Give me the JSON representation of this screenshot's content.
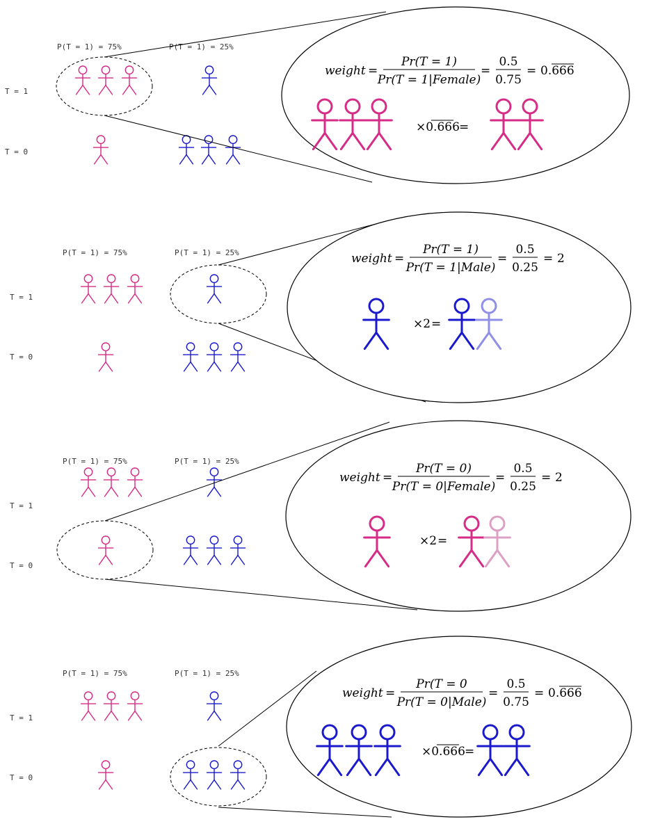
{
  "colors": {
    "female": "#d62b86",
    "female_light": "#dda0c4",
    "male": "#1a1acc",
    "male_light": "#8f8fe8",
    "line": "#000000"
  },
  "panels": [
    {
      "p_female_label": "P(T = 1) = 75%",
      "p_male_label": "P(T = 1) = 25%",
      "t1_label": "T = 1",
      "t0_label": "T = 0",
      "focus": "female-T1",
      "formula": {
        "lhs": "weight",
        "eq": "=",
        "num": "Pr(T = 1)",
        "den": "Pr(T = 1|Female)",
        "frac_num": "0.5",
        "frac_den": "0.75",
        "result": "0.666",
        "result_overline": "666"
      },
      "multiplier": "×0.666",
      "multiplier_overline": "666",
      "result_eq": "="
    },
    {
      "p_female_label": "P(T = 1) = 75%",
      "p_male_label": "P(T = 1) = 25%",
      "t1_label": "T = 1",
      "t0_label": "T = 0",
      "focus": "male-T1",
      "formula": {
        "lhs": "weight",
        "eq": "=",
        "num": "Pr(T = 1)",
        "den": "Pr(T = 1|Male)",
        "frac_num": "0.5",
        "frac_den": "0.25",
        "result": "2",
        "result_overline": ""
      },
      "multiplier": "×2",
      "multiplier_overline": "",
      "result_eq": "="
    },
    {
      "p_female_label": "P(T = 1) = 75%",
      "p_male_label": "P(T = 1) = 25%",
      "t1_label": "T = 1",
      "t0_label": "T = 0",
      "focus": "female-T0",
      "formula": {
        "lhs": "weight",
        "eq": "=",
        "num": "Pr(T = 0)",
        "den": "Pr(T = 0|Female)",
        "frac_num": "0.5",
        "frac_den": "0.25",
        "result": "2",
        "result_overline": ""
      },
      "multiplier": "×2",
      "multiplier_overline": "",
      "result_eq": "="
    },
    {
      "p_female_label": "P(T = 1) = 75%",
      "p_male_label": "P(T = 1) = 25%",
      "t1_label": "T = 1",
      "t0_label": "T = 0",
      "focus": "male-T0",
      "formula": {
        "lhs": "weight",
        "eq": "=",
        "num": "Pr(T = 0",
        "den": "Pr(T = 0|Male)",
        "frac_num": "0.5",
        "frac_den": "0.75",
        "result": "0.666",
        "result_overline": "666"
      },
      "multiplier": "×0.666",
      "multiplier_overline": "666",
      "result_eq": "="
    }
  ]
}
